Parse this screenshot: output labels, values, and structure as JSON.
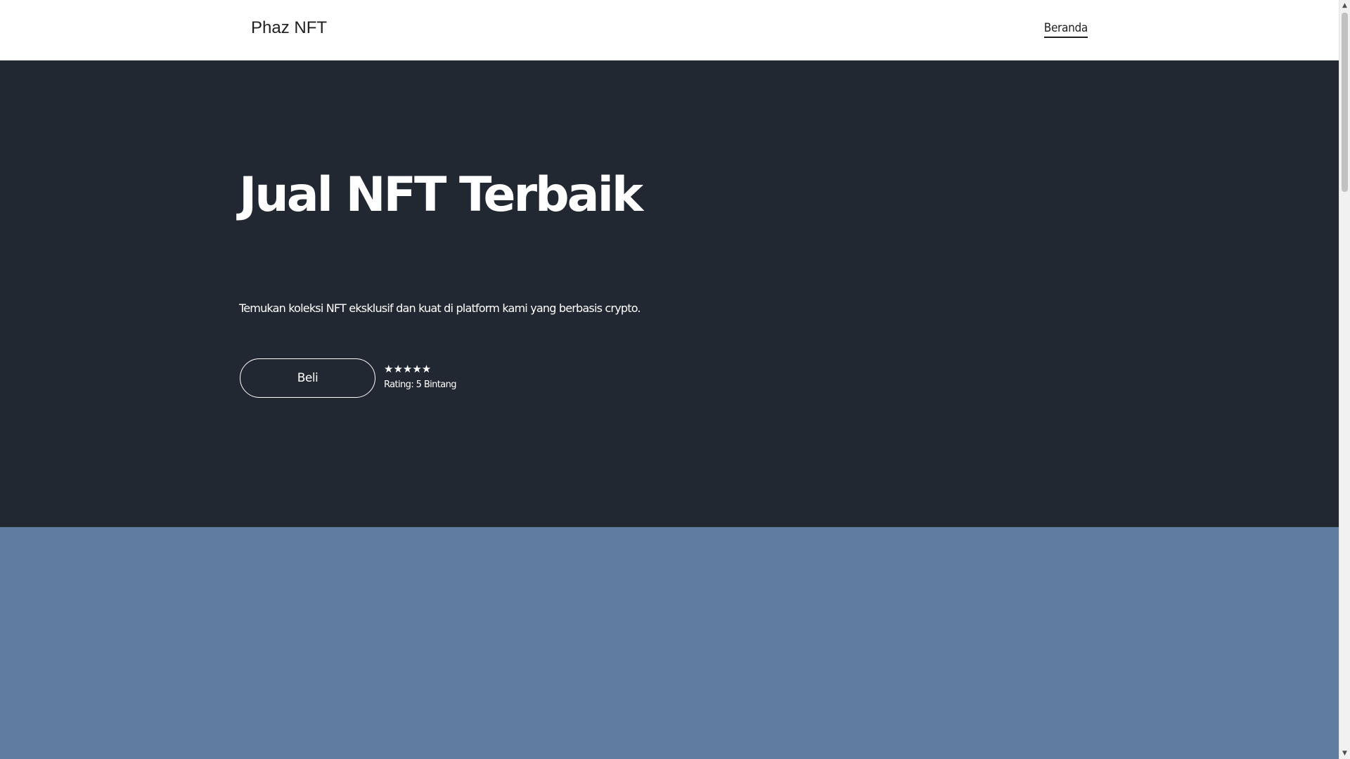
{
  "header": {
    "brand": "Phaz NFT",
    "nav": [
      {
        "label": "Beranda"
      }
    ]
  },
  "hero": {
    "title": "Jual NFT Terbaik",
    "description": "Temukan koleksi NFT eksklusif dan kuat di platform kami yang berbasis crypto.",
    "buy_label": "Beli",
    "stars": "★★★★★",
    "rating_text": "Rating: 5 Bintang"
  },
  "colors": {
    "hero_bg": "#212831",
    "section_bg": "#607ca0",
    "header_bg": "#ffffff"
  },
  "icons": {
    "scroll_up": "▲",
    "scroll_down": "▼"
  }
}
